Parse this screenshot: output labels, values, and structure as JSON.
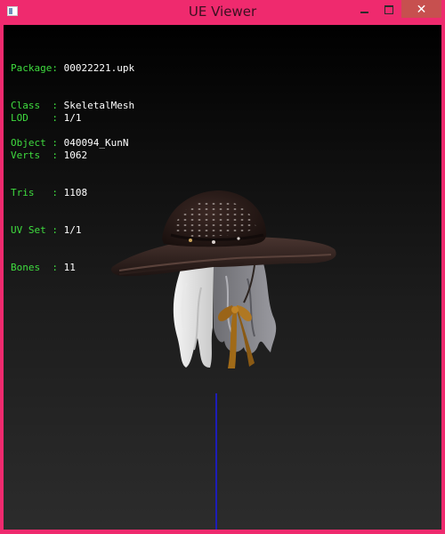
{
  "window": {
    "title": "UE Viewer",
    "close_glyph": "✕"
  },
  "mesh_info": {
    "rows": [
      {
        "key": "Package",
        "value": "00022221.upk"
      },
      {
        "key": "Class  ",
        "value": "SkeletalMesh"
      },
      {
        "key": "Object ",
        "value": "040094_KunN"
      }
    ],
    "stats": [
      {
        "key": "LOD    ",
        "value": "1/1"
      },
      {
        "key": "Verts  ",
        "value": "1062"
      },
      {
        "key": "Tris   ",
        "value": "1108"
      },
      {
        "key": "UV Set ",
        "value": "1/1"
      },
      {
        "key": "Bones  ",
        "value": "11"
      }
    ]
  },
  "colors": {
    "frame": "#ef2a6e",
    "label": "#3fdc3f",
    "value": "#ffffff",
    "axis": "#1d1db8"
  }
}
